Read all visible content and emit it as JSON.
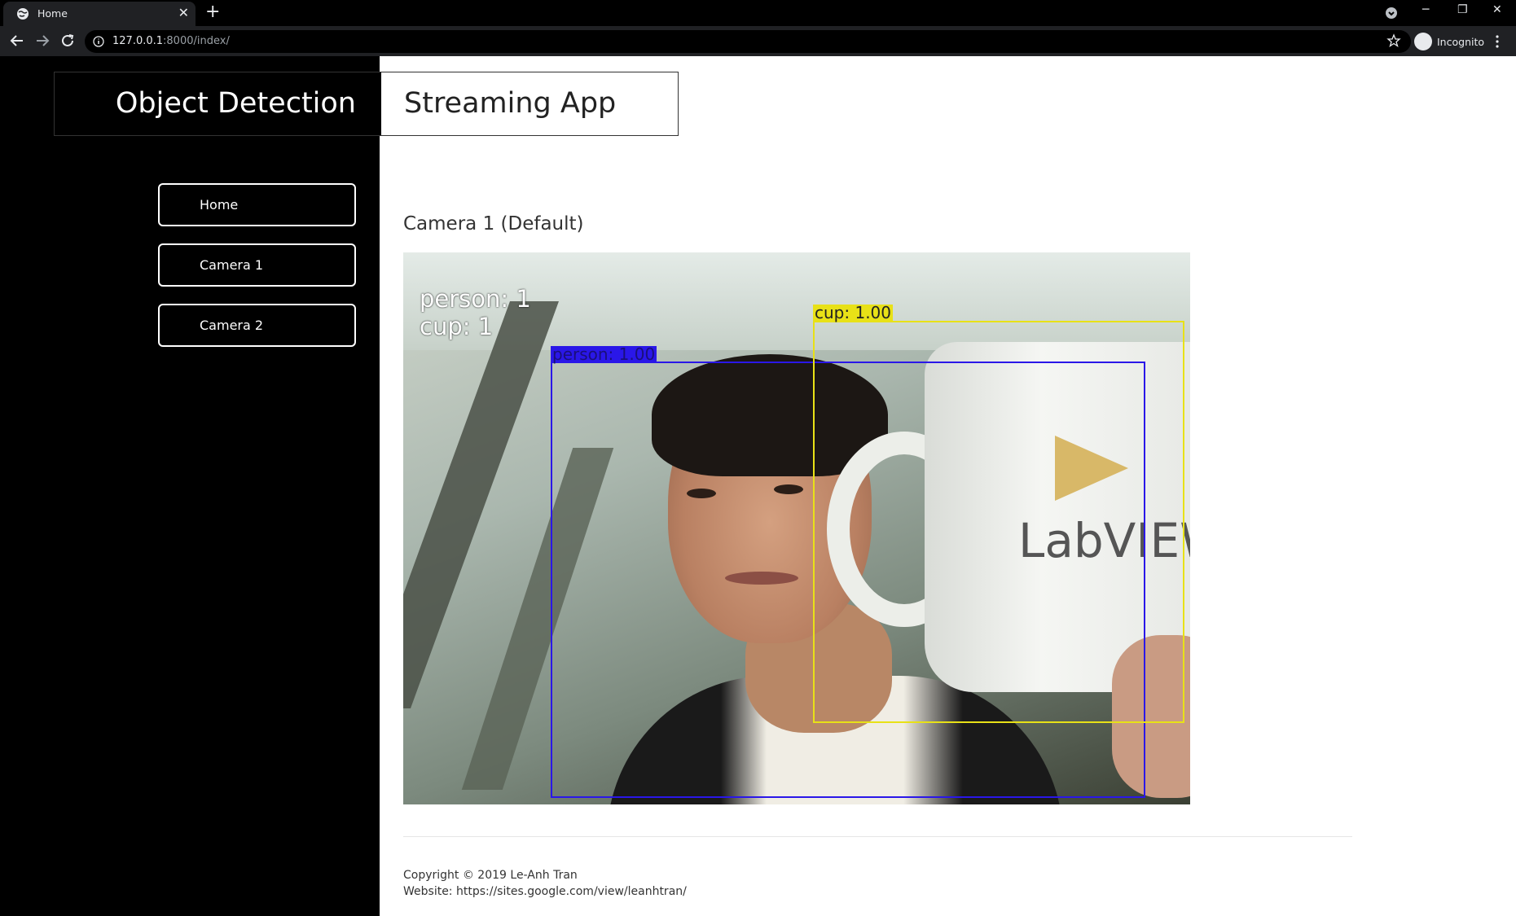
{
  "browser": {
    "tab_title": "Home",
    "url_host": "127.0.0.1",
    "url_rest": ":8000/index/",
    "profile_label": "Incognito"
  },
  "header": {
    "left_text": "Object Detection",
    "right_text": "Streaming App"
  },
  "sidebar": {
    "items": [
      {
        "label": "Home"
      },
      {
        "label": "Camera 1"
      },
      {
        "label": "Camera 2"
      }
    ]
  },
  "main": {
    "camera_title": "Camera 1 (Default)",
    "detections": {
      "counts": [
        "person:  1",
        "cup:  1"
      ],
      "boxes": [
        {
          "label": "person:  1.00",
          "color": "#2a17e8"
        },
        {
          "label": "cup:  1.00",
          "color": "#e8e117"
        }
      ]
    },
    "mug_text": "LabVIEW"
  },
  "footer": {
    "copyright": "Copyright © 2019 Le-Anh Tran",
    "website": "Website: https://sites.google.com/view/leanhtran/"
  }
}
